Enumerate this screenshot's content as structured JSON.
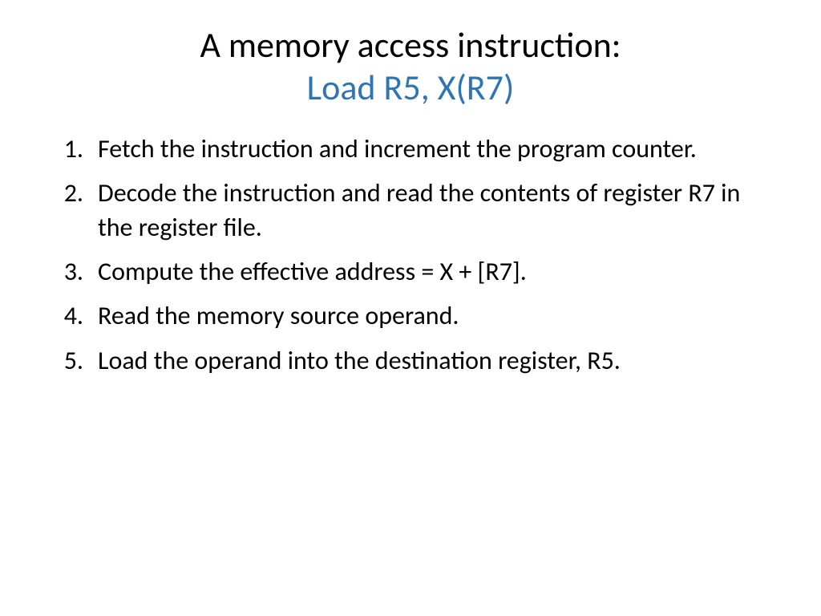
{
  "title": {
    "line1": "A memory access instruction:",
    "line2": "Load R5, X(R7)"
  },
  "steps": [
    {
      "num": "1.",
      "text": "Fetch the instruction and increment the program counter."
    },
    {
      "num": "2.",
      "text": "Decode the instruction and read the contents of register R7 in the register file."
    },
    {
      "num": "3.",
      "text": "Compute the effective address = X + [R7]."
    },
    {
      "num": "4.",
      "text": "Read the memory source operand."
    },
    {
      "num": "5.",
      "text": "Load the operand into the destination register, R5."
    }
  ]
}
